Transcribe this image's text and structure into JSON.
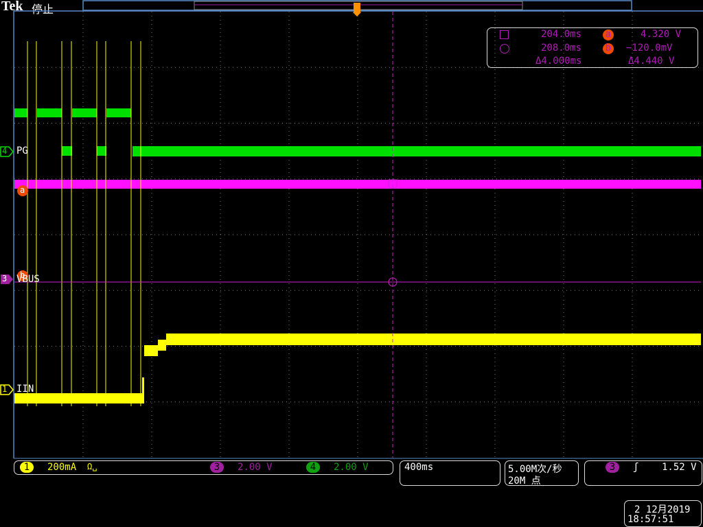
{
  "header": {
    "brand": "Tek",
    "state": "停止"
  },
  "channels": {
    "ch4": {
      "num": "4",
      "label": "PG",
      "color": "#00e000"
    },
    "ch3": {
      "num": "3",
      "label": "VBUS",
      "color": "#d020d0"
    },
    "ch1": {
      "num": "1",
      "label": "IIN",
      "color": "#ffff00"
    }
  },
  "cursor_labels": {
    "a": "a",
    "b": "b"
  },
  "measurements": {
    "t1": "204.0ms",
    "t2": "208.0ms",
    "dt": "Δ4.000ms",
    "v1": "4.320 V",
    "v2": "−120.0mV",
    "dv": "Δ4.440 V"
  },
  "status": {
    "ch1_scale": "200mA",
    "ch1_suffix": "Ω␣",
    "ch3_scale": "2.00 V",
    "ch4_scale": "2.00 V",
    "timebase": "400ms",
    "sample_rate": "5.00M次/秒",
    "record_length": "20M 点",
    "trigger_source": "3",
    "trigger_slope": "ʃ",
    "trigger_level": "1.52 V",
    "date": "2 12月2019",
    "time": "18:57:51"
  }
}
